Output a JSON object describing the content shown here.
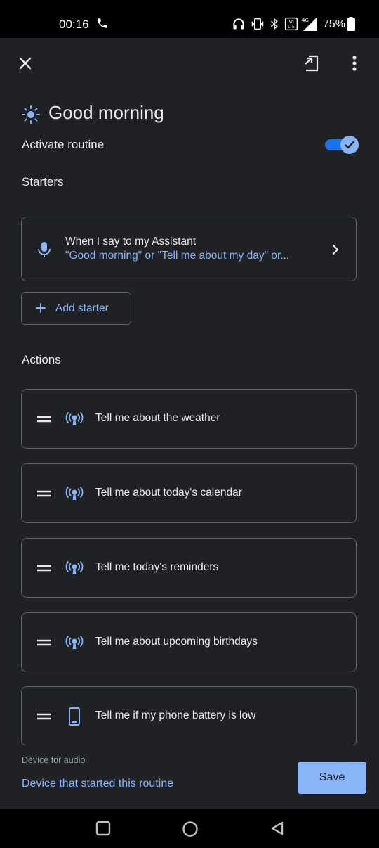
{
  "status_bar": {
    "time": "00:16",
    "battery": "75%",
    "icons": [
      "phone-call-icon",
      "headphones-icon",
      "vibrate-icon",
      "bluetooth-icon",
      "volte-icon",
      "signal-4g-icon",
      "battery-icon"
    ]
  },
  "app_bar": {
    "icons": [
      "close-icon",
      "add-shortcut-icon",
      "more-vert-icon"
    ]
  },
  "routine": {
    "title": "Good morning",
    "title_icon": "sun-icon",
    "activate_label": "Activate routine",
    "activated": true
  },
  "starters": {
    "heading": "Starters",
    "card": {
      "icon": "mic-icon",
      "title": "When I say to my Assistant",
      "subtitle": "\"Good morning\" or \"Tell me about my day\" or..."
    },
    "add_label": "Add starter"
  },
  "actions": {
    "heading": "Actions",
    "items": [
      {
        "label": "Tell me about the weather",
        "icon": "assistant-broadcast-icon"
      },
      {
        "label": "Tell me about today's calendar",
        "icon": "assistant-broadcast-icon"
      },
      {
        "label": "Tell me today's reminders",
        "icon": "assistant-broadcast-icon"
      },
      {
        "label": "Tell me about upcoming birthdays",
        "icon": "assistant-broadcast-icon"
      },
      {
        "label": "Tell me if my phone battery is low",
        "icon": "phone-icon"
      }
    ]
  },
  "footer": {
    "device_label": "Device for audio",
    "device_value": "Device that started this routine",
    "save_label": "Save"
  },
  "nav_bar": {
    "icons": [
      "recents-icon",
      "home-icon",
      "back-icon"
    ]
  },
  "colors": {
    "background": "#202124",
    "accent": "#8ab4f8",
    "toggle_track": "#1a73e8",
    "border": "#5f6368"
  }
}
